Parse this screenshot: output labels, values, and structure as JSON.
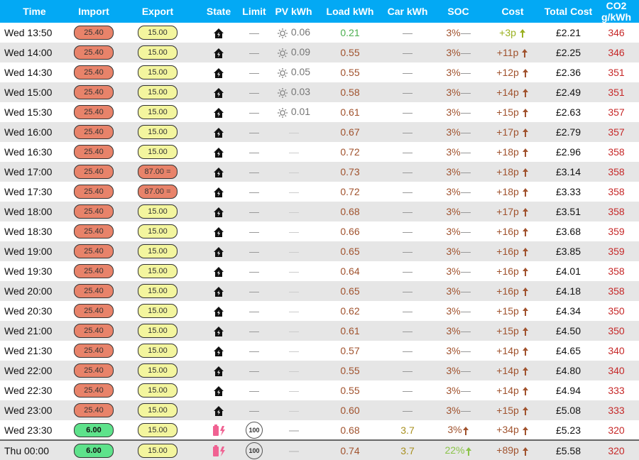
{
  "headers": [
    "Time",
    "Import",
    "Export",
    "State",
    "Limit",
    "PV kWh",
    "Load kWh",
    "Car kWh",
    "SOC",
    "Cost",
    "Total Cost",
    "CO2 g/kWh"
  ],
  "colors": {
    "header_bg": "#03a9f4",
    "import_red": "#e8836a",
    "import_green": "#5ee28b",
    "export_yellow": "#f3f59e",
    "co2": "#c62828",
    "soc_cost": "#a0522d"
  },
  "rows": [
    {
      "time": "Wed 13:50",
      "import": "25.40",
      "export": "15.00",
      "state": "home-icon",
      "limit": "—",
      "pv": "0.06",
      "pv_icon": "sun-icon",
      "load": "0.21",
      "car": "—",
      "soc": "3%",
      "cost": "+3p",
      "total": "£2.21",
      "co2": "346"
    },
    {
      "time": "Wed 14:00",
      "import": "25.40",
      "export": "15.00",
      "state": "home-icon",
      "limit": "—",
      "pv": "0.09",
      "pv_icon": "sun-icon",
      "load": "0.55",
      "car": "—",
      "soc": "3%",
      "cost": "+11p",
      "total": "£2.25",
      "co2": "346"
    },
    {
      "time": "Wed 14:30",
      "import": "25.40",
      "export": "15.00",
      "state": "home-icon",
      "limit": "—",
      "pv": "0.05",
      "pv_icon": "sun-icon",
      "load": "0.55",
      "car": "—",
      "soc": "3%",
      "cost": "+12p",
      "total": "£2.36",
      "co2": "351"
    },
    {
      "time": "Wed 15:00",
      "import": "25.40",
      "export": "15.00",
      "state": "home-icon",
      "limit": "—",
      "pv": "0.03",
      "pv_icon": "sun-icon",
      "load": "0.58",
      "car": "—",
      "soc": "3%",
      "cost": "+14p",
      "total": "£2.49",
      "co2": "351"
    },
    {
      "time": "Wed 15:30",
      "import": "25.40",
      "export": "15.00",
      "state": "home-icon",
      "limit": "—",
      "pv": "0.01",
      "pv_icon": "sun-icon",
      "load": "0.61",
      "car": "—",
      "soc": "3%",
      "cost": "+15p",
      "total": "£2.63",
      "co2": "357"
    },
    {
      "time": "Wed 16:00",
      "import": "25.40",
      "export": "15.00",
      "state": "home-icon",
      "limit": "—",
      "pv": "—",
      "load": "0.67",
      "car": "—",
      "soc": "3%",
      "cost": "+17p",
      "total": "£2.79",
      "co2": "357"
    },
    {
      "time": "Wed 16:30",
      "import": "25.40",
      "export": "15.00",
      "state": "home-icon",
      "limit": "—",
      "pv": "—",
      "load": "0.72",
      "car": "—",
      "soc": "3%",
      "cost": "+18p",
      "total": "£2.96",
      "co2": "358"
    },
    {
      "time": "Wed 17:00",
      "import": "25.40",
      "export": "87.00 =",
      "state": "home-icon",
      "limit": "—",
      "pv": "—",
      "load": "0.73",
      "car": "—",
      "soc": "3%",
      "cost": "+18p",
      "total": "£3.14",
      "co2": "358"
    },
    {
      "time": "Wed 17:30",
      "import": "25.40",
      "export": "87.00 =",
      "state": "home-icon",
      "limit": "—",
      "pv": "—",
      "load": "0.72",
      "car": "—",
      "soc": "3%",
      "cost": "+18p",
      "total": "£3.33",
      "co2": "358"
    },
    {
      "time": "Wed 18:00",
      "import": "25.40",
      "export": "15.00",
      "state": "home-icon",
      "limit": "—",
      "pv": "—",
      "load": "0.68",
      "car": "—",
      "soc": "3%",
      "cost": "+17p",
      "total": "£3.51",
      "co2": "358"
    },
    {
      "time": "Wed 18:30",
      "import": "25.40",
      "export": "15.00",
      "state": "home-icon",
      "limit": "—",
      "pv": "—",
      "load": "0.66",
      "car": "—",
      "soc": "3%",
      "cost": "+16p",
      "total": "£3.68",
      "co2": "359"
    },
    {
      "time": "Wed 19:00",
      "import": "25.40",
      "export": "15.00",
      "state": "home-icon",
      "limit": "—",
      "pv": "—",
      "load": "0.65",
      "car": "—",
      "soc": "3%",
      "cost": "+16p",
      "total": "£3.85",
      "co2": "359"
    },
    {
      "time": "Wed 19:30",
      "import": "25.40",
      "export": "15.00",
      "state": "home-icon",
      "limit": "—",
      "pv": "—",
      "load": "0.64",
      "car": "—",
      "soc": "3%",
      "cost": "+16p",
      "total": "£4.01",
      "co2": "358"
    },
    {
      "time": "Wed 20:00",
      "import": "25.40",
      "export": "15.00",
      "state": "home-icon",
      "limit": "—",
      "pv": "—",
      "load": "0.65",
      "car": "—",
      "soc": "3%",
      "cost": "+16p",
      "total": "£4.18",
      "co2": "358"
    },
    {
      "time": "Wed 20:30",
      "import": "25.40",
      "export": "15.00",
      "state": "home-icon",
      "limit": "—",
      "pv": "—",
      "load": "0.62",
      "car": "—",
      "soc": "3%",
      "cost": "+15p",
      "total": "£4.34",
      "co2": "350"
    },
    {
      "time": "Wed 21:00",
      "import": "25.40",
      "export": "15.00",
      "state": "home-icon",
      "limit": "—",
      "pv": "—",
      "load": "0.61",
      "car": "—",
      "soc": "3%",
      "cost": "+15p",
      "total": "£4.50",
      "co2": "350"
    },
    {
      "time": "Wed 21:30",
      "import": "25.40",
      "export": "15.00",
      "state": "home-icon",
      "limit": "—",
      "pv": "—",
      "load": "0.57",
      "car": "—",
      "soc": "3%",
      "cost": "+14p",
      "total": "£4.65",
      "co2": "340"
    },
    {
      "time": "Wed 22:00",
      "import": "25.40",
      "export": "15.00",
      "state": "home-icon",
      "limit": "—",
      "pv": "—",
      "load": "0.55",
      "car": "—",
      "soc": "3%",
      "cost": "+14p",
      "total": "£4.80",
      "co2": "340"
    },
    {
      "time": "Wed 22:30",
      "import": "25.40",
      "export": "15.00",
      "state": "home-icon",
      "limit": "—",
      "pv": "—",
      "load": "0.55",
      "car": "—",
      "soc": "3%",
      "cost": "+14p",
      "total": "£4.94",
      "co2": "333"
    },
    {
      "time": "Wed 23:00",
      "import": "25.40",
      "export": "15.00",
      "state": "home-icon",
      "limit": "—",
      "pv": "—",
      "load": "0.60",
      "car": "—",
      "soc": "3%",
      "cost": "+15p",
      "total": "£5.08",
      "co2": "333"
    },
    {
      "time": "Wed 23:30",
      "import": "6.00",
      "export": "15.00",
      "state": "battery-charging-icon",
      "limit": "100",
      "pv": "—",
      "load": "0.68",
      "car": "3.7",
      "soc": "3%",
      "cost": "+34p",
      "total": "£5.23",
      "co2": "320"
    },
    {
      "time": "Thu 00:00",
      "import": "6.00",
      "export": "15.00",
      "state": "battery-charging-icon",
      "limit": "100",
      "pv": "—",
      "load": "0.74",
      "car": "3.7",
      "soc": "22%",
      "cost": "+89p",
      "total": "£5.58",
      "co2": "320"
    }
  ]
}
